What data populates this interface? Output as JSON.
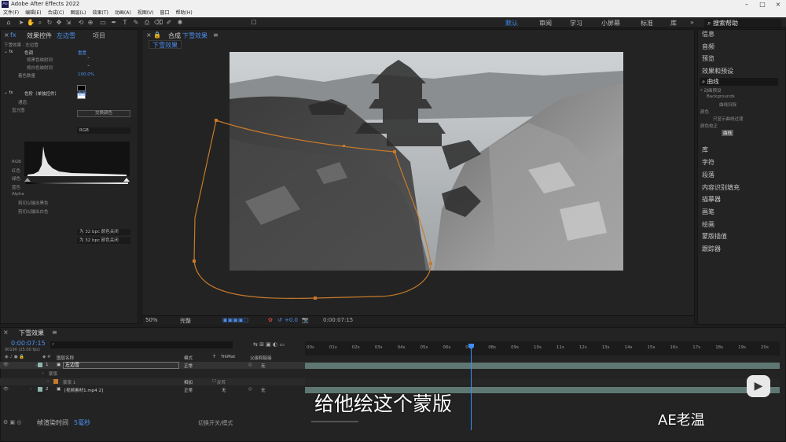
{
  "app": {
    "title": "Adobe After Effects 2022",
    "logo": "Ae"
  },
  "menu": [
    "文件(F)",
    "编辑(E)",
    "合成(C)",
    "图层(L)",
    "效果(T)",
    "动画(A)",
    "视图(V)",
    "窗口",
    "帮助(H)"
  ],
  "toolbar": {
    "align_label": "对齐"
  },
  "workspaces": {
    "default": "默认",
    "review": "审阅",
    "learn": "学习",
    "small_screen": "小屏幕",
    "standard": "标准",
    "library": "库",
    "search": "搜索帮助"
  },
  "effect_controls": {
    "tab_label": "效果控件",
    "layer_name": "左边雪",
    "project_tab": "项目",
    "breadcrumb": "下雪效果 · 左边雪",
    "tint": {
      "name": "色调",
      "reset": "重置",
      "map_black": "将黑色映射到",
      "map_white": "将白色映射到",
      "amount": "着色数量",
      "amount_value": "100.0%",
      "swap_button": "交换颜色"
    },
    "levels": {
      "name": "色阶（单独控件）",
      "reset": "重置",
      "channel_label": "通道:",
      "channel_value": "RGB",
      "histogram": "直方图",
      "rows": [
        "RGB",
        "红色",
        "绿色",
        "蓝色",
        "Alpha"
      ],
      "clip_black": "剪切以输出黑色",
      "clip_white": "剪切以输出白色",
      "clip_value": "为 32 bpc 颜色关闭"
    }
  },
  "composition": {
    "panel_label": "合成",
    "comp_name": "下雪效果",
    "tab_name": "下雪效果",
    "zoom": "50%",
    "quality": "完整",
    "exposure": "+0.0",
    "timecode": "0:00:07:15"
  },
  "right_panel": {
    "items_top": [
      "信息",
      "音频",
      "预览",
      "效果和预设"
    ],
    "search_value": "曲线",
    "tree": [
      "* 动画预设",
      "Backgrounds",
      "曲线扫除",
      "颜色",
      "只显示曲线过渡",
      "颜色校正",
      "曲线"
    ],
    "items_bottom": [
      "库",
      "字符",
      "段落",
      "内容识别填充",
      "描摹器",
      "画笔",
      "绘画",
      "蒙版插值",
      "跟踪器"
    ]
  },
  "timeline": {
    "tab_label": "下雪效果",
    "timecode": "0:00:07:15",
    "sub_timecode": "00190 (25.00 fps)",
    "col_layer": "图层名称",
    "col_mode": "模式",
    "col_t": "T",
    "col_trkmat": "TrkMat",
    "col_parent": "父级和链接",
    "rulers": [
      "00s",
      "01s",
      "02s",
      "03s",
      "04s",
      "05s",
      "06s",
      "07s",
      "08s",
      "09s",
      "10s",
      "11s",
      "12s",
      "13s",
      "14s",
      "15s",
      "16s",
      "17s",
      "18s",
      "19s",
      "20s"
    ],
    "layers": [
      {
        "num": "1",
        "name": "左边雪",
        "mode": "正常",
        "parent": "无"
      },
      {
        "num": "2",
        "name": "[视频素材1.mp4 2]",
        "mode": "正常",
        "trkmat": "无",
        "parent": "无"
      }
    ],
    "mask_group": "蒙版",
    "mask_name": "蒙版 1",
    "mask_mode": "相加",
    "mask_inverted": "反转",
    "footer_render": "帧渲染时间",
    "footer_render_value": "5毫秒",
    "footer_toggle": "切换开关/模式"
  },
  "overlay": {
    "caption": "给他绘这个蒙版",
    "watermark": "AE老温"
  },
  "colors": {
    "accent": "#3e8ef7",
    "mask": "#c77a2a",
    "track": "#5f7773",
    "playhead": "#3e8ef7"
  }
}
